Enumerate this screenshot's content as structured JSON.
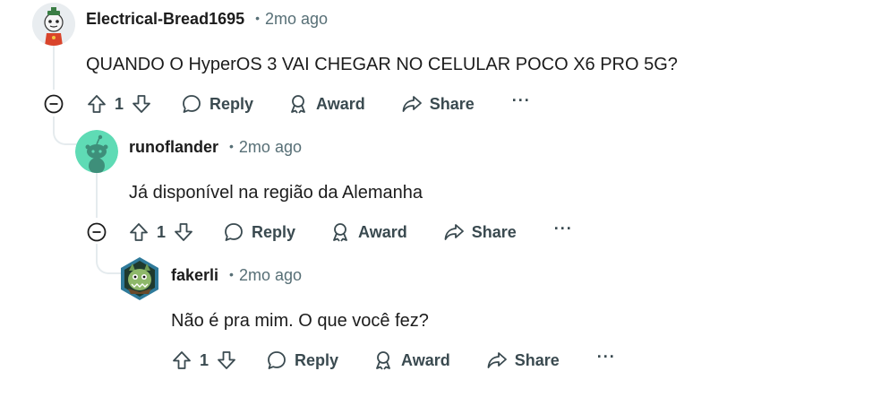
{
  "comments": [
    {
      "username": "Electrical-Bread1695",
      "separator": "•",
      "time": "2mo ago",
      "text": "QUANDO O HyperOS 3 VAI CHEGAR NO CELULAR POCO X6 PRO 5G?",
      "votes": "1",
      "reply_label": "Reply",
      "award_label": "Award",
      "share_label": "Share",
      "more_label": "···"
    },
    {
      "username": "runoflander",
      "separator": "•",
      "time": "2mo ago",
      "text": "Já disponível na região da Alemanha",
      "votes": "1",
      "reply_label": "Reply",
      "award_label": "Award",
      "share_label": "Share",
      "more_label": "···"
    },
    {
      "username": "fakerli",
      "separator": "•",
      "time": "2mo ago",
      "text": "Não é pra mim. O que você fez?",
      "votes": "1",
      "reply_label": "Reply",
      "award_label": "Award",
      "share_label": "Share",
      "more_label": "···"
    }
  ],
  "icons": {
    "upvote": "upvote-arrow-icon",
    "downvote": "downvote-arrow-icon",
    "reply": "speech-bubble-icon",
    "award": "award-ribbon-icon",
    "share": "share-arrow-icon",
    "collapse": "collapse-minus-icon"
  },
  "colors": {
    "text": "#1c1c1c",
    "meta": "#576f76",
    "action": "#3a4a50",
    "thread_line": "#e5ebee",
    "snoo_bg": "#5fdbb5"
  }
}
